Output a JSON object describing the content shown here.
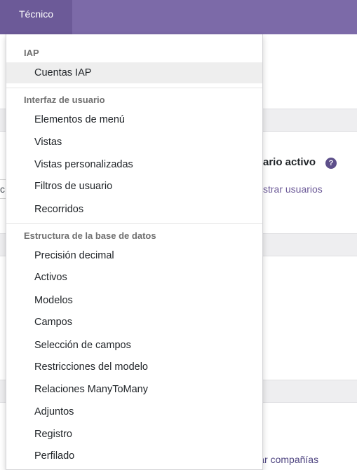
{
  "topbar": {
    "tab_label": "Técnico"
  },
  "background": {
    "input_stub_text": "c",
    "section_heading": "ario activo",
    "help_icon": "question-circle-icon",
    "link_text": "strar usuarios",
    "bottom_link_text": "Administrar compañías",
    "bottom_link_icon": "arrow-right-icon"
  },
  "menu": {
    "sections": [
      {
        "header": "IAP",
        "items": [
          "Cuentas IAP"
        ]
      },
      {
        "header": "Interfaz de usuario",
        "items": [
          "Elementos de menú",
          "Vistas",
          "Vistas personalizadas",
          "Filtros de usuario",
          "Recorridos"
        ]
      },
      {
        "header": "Estructura de la base de datos",
        "items": [
          "Precisión decimal",
          "Activos",
          "Modelos",
          "Campos",
          "Selección de campos",
          "Restricciones del modelo",
          "Relaciones ManyToMany",
          "Adjuntos",
          "Registro",
          "Perfilado"
        ]
      }
    ],
    "active_item": "Cuentas IAP"
  },
  "colors": {
    "topbar": "#7c6aa8",
    "topbar_active": "#6c5a98",
    "link": "#6c5a98",
    "active_item_bg": "#eeeeee"
  }
}
